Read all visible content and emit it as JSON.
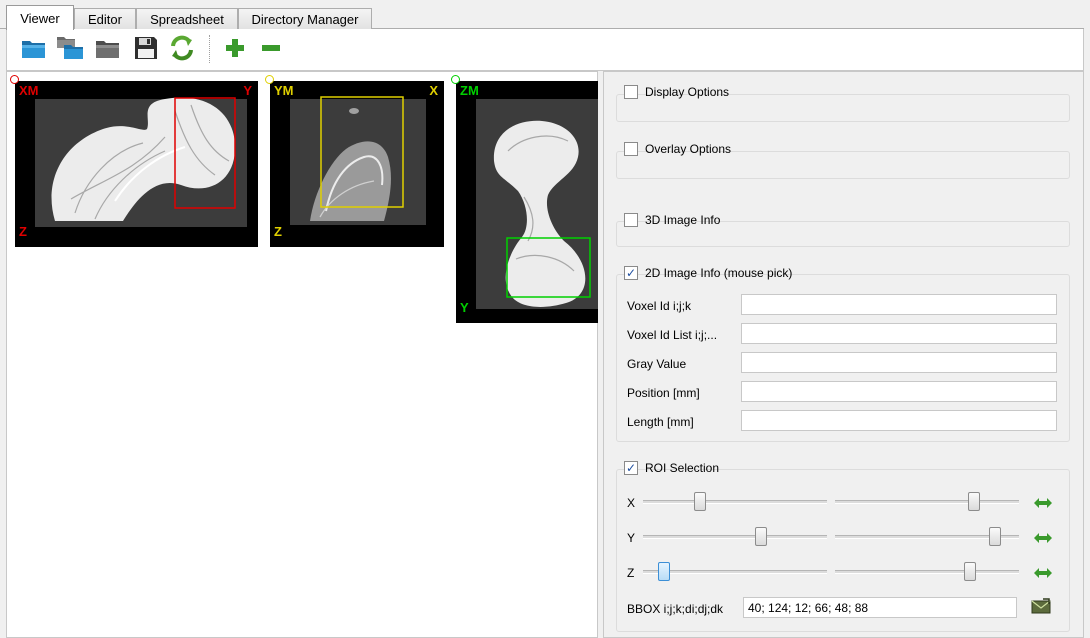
{
  "tabs": [
    {
      "label": "Viewer",
      "active": true
    },
    {
      "label": "Editor",
      "active": false
    },
    {
      "label": "Spreadsheet",
      "active": false
    },
    {
      "label": "Directory Manager",
      "active": false
    }
  ],
  "toolbar": {
    "icons": [
      "folder-open-icon",
      "folder-stack-icon",
      "folder-gray-icon",
      "save-icon",
      "refresh-icon",
      "plus-icon",
      "minus-icon"
    ]
  },
  "views": [
    {
      "name": "x-view",
      "tl": "XM",
      "tr": "Y",
      "bl": "Z",
      "color": "#e00000"
    },
    {
      "name": "y-view",
      "tl": "YM",
      "tr": "X",
      "bl": "Z",
      "color": "#e0d000"
    },
    {
      "name": "z-view",
      "tl": "ZM",
      "tr": "",
      "bl": "Y",
      "color": "#00d000"
    }
  ],
  "groups": {
    "display_options": {
      "label": "Display Options",
      "checked": false
    },
    "overlay_options": {
      "label": "Overlay Options",
      "checked": false
    },
    "image3d_info": {
      "label": "3D Image Info",
      "checked": false
    },
    "image2d_info": {
      "label": "2D Image Info (mouse pick)",
      "checked": true,
      "fields": [
        {
          "label": "Voxel Id  i;j;k",
          "value": ""
        },
        {
          "label": "Voxel Id List  i;j;...",
          "value": ""
        },
        {
          "label": "Gray Value",
          "value": ""
        },
        {
          "label": "Position  [mm]",
          "value": ""
        },
        {
          "label": "Length  [mm]",
          "value": ""
        }
      ]
    },
    "roi_selection": {
      "label": "ROI Selection",
      "checked": true,
      "sliders": [
        {
          "axis": "X",
          "low": 0.32,
          "high": 0.75
        },
        {
          "axis": "Y",
          "low": 0.62,
          "high": 0.87
        },
        {
          "axis": "Z",
          "low": 0.12,
          "high": 0.72
        }
      ],
      "bbox_label": "BBOX i;j;k;di;dj;dk",
      "bbox_value": "40; 124; 12; 66; 48; 88"
    }
  },
  "colors": {
    "accent": "#2e7d32",
    "check": "#1f4fa0"
  }
}
